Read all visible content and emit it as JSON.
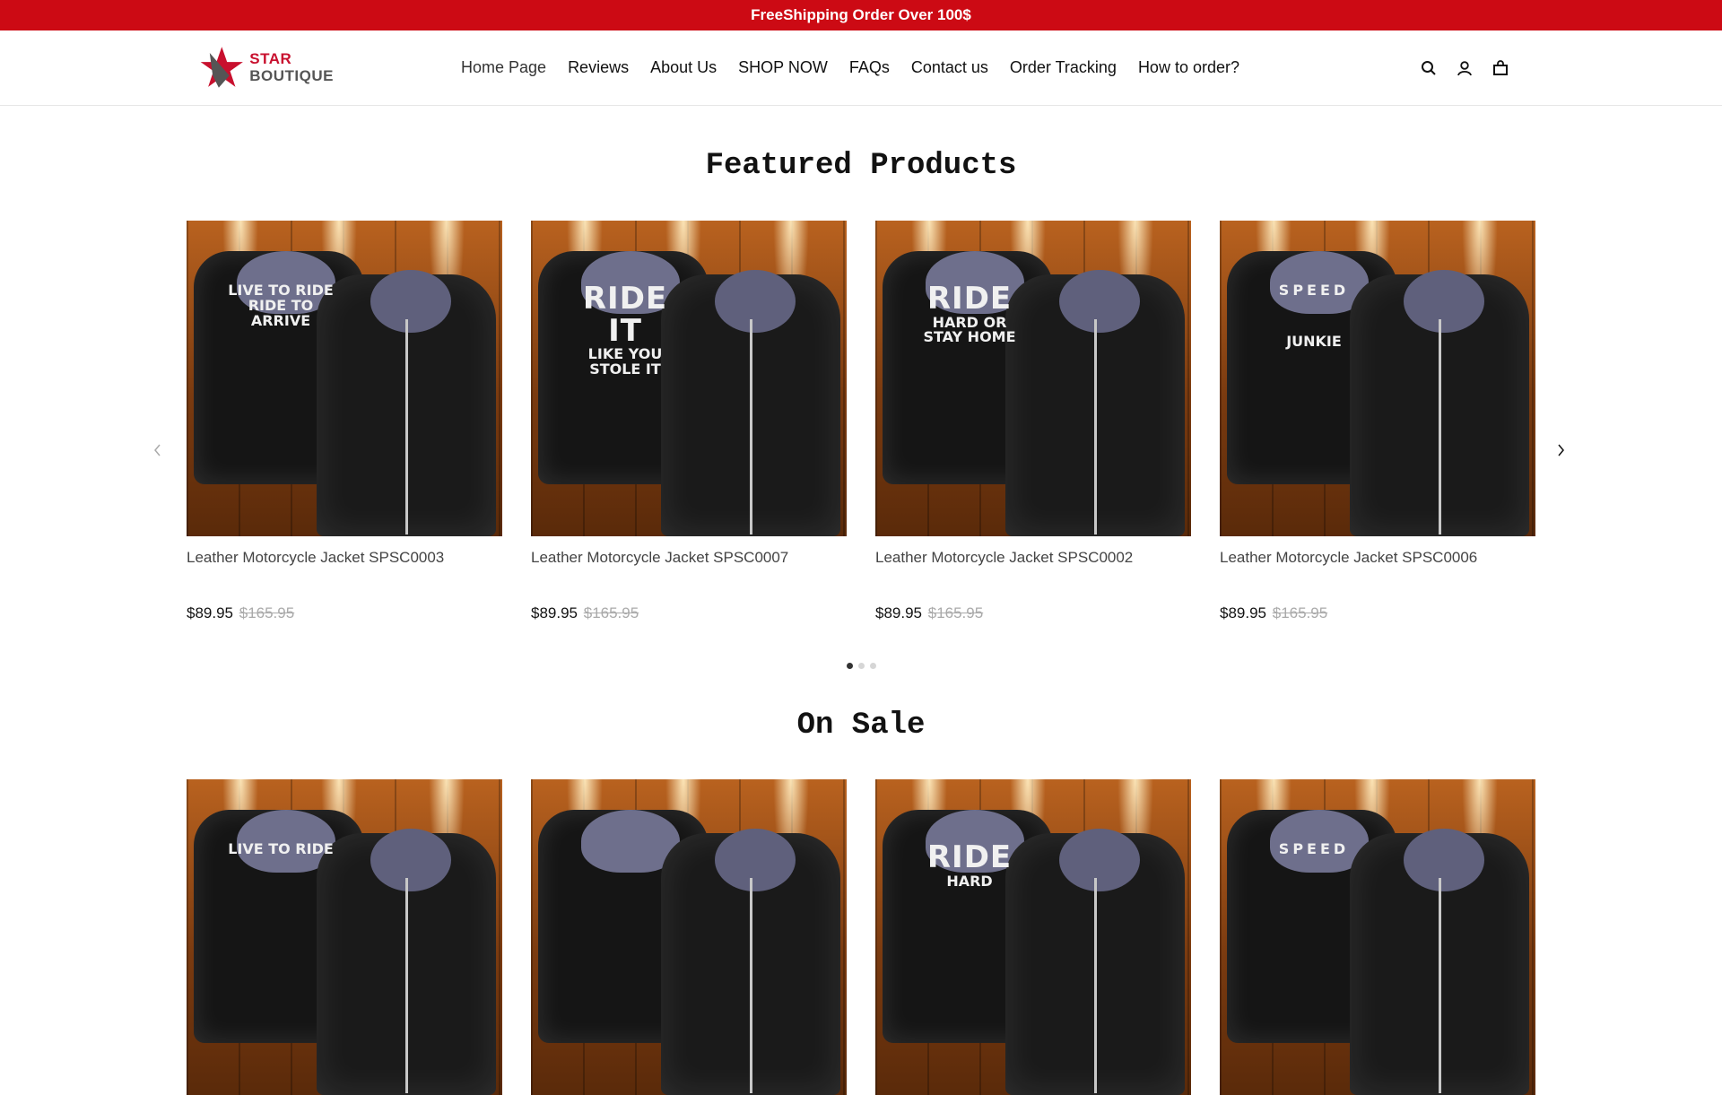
{
  "announcement": {
    "text": "FreeShipping Order Over 100$"
  },
  "header": {
    "logo": {
      "line1": "STAR",
      "line2": "BOUTIQUE"
    },
    "nav": [
      {
        "label": "Home Page",
        "active": true
      },
      {
        "label": "Reviews"
      },
      {
        "label": "About Us"
      },
      {
        "label": "SHOP NOW"
      },
      {
        "label": "FAQs"
      },
      {
        "label": "Contact us"
      },
      {
        "label": "Order Tracking"
      },
      {
        "label": "How to order?"
      }
    ],
    "icons": [
      "search-icon",
      "account-icon",
      "cart-icon"
    ]
  },
  "featured": {
    "title": "Featured Products",
    "products": [
      {
        "title": "Leather Motorcycle Jacket SPSC0003",
        "price": "$89.95",
        "old_price": "$165.95",
        "print": [
          "LIVE TO RIDE",
          "RIDE TO ARRIVE"
        ]
      },
      {
        "title": "Leather Motorcycle Jacket SPSC0007",
        "price": "$89.95",
        "old_price": "$165.95",
        "print": [
          "RIDE IT",
          "LIKE YOU STOLE IT"
        ]
      },
      {
        "title": "Leather Motorcycle Jacket SPSC0002",
        "price": "$89.95",
        "old_price": "$165.95",
        "print": [
          "RIDE",
          "HARD OR STAY HOME"
        ]
      },
      {
        "title": "Leather Motorcycle Jacket SPSC0006",
        "price": "$89.95",
        "old_price": "$165.95",
        "print": [
          "SPEED",
          "JUNKIE"
        ]
      }
    ],
    "pagination": {
      "pages": 3,
      "current": 1
    }
  },
  "on_sale": {
    "title": "On Sale",
    "products": [
      {
        "print": [
          "LIVE TO RIDE",
          ""
        ]
      },
      {
        "print": [
          "",
          ""
        ]
      },
      {
        "print": [
          "RIDE",
          "HARD"
        ]
      },
      {
        "print": [
          "SPEED",
          ""
        ]
      }
    ]
  },
  "colors": {
    "announcement_bg": "#cc0a14",
    "brand_red": "#c8102e"
  }
}
